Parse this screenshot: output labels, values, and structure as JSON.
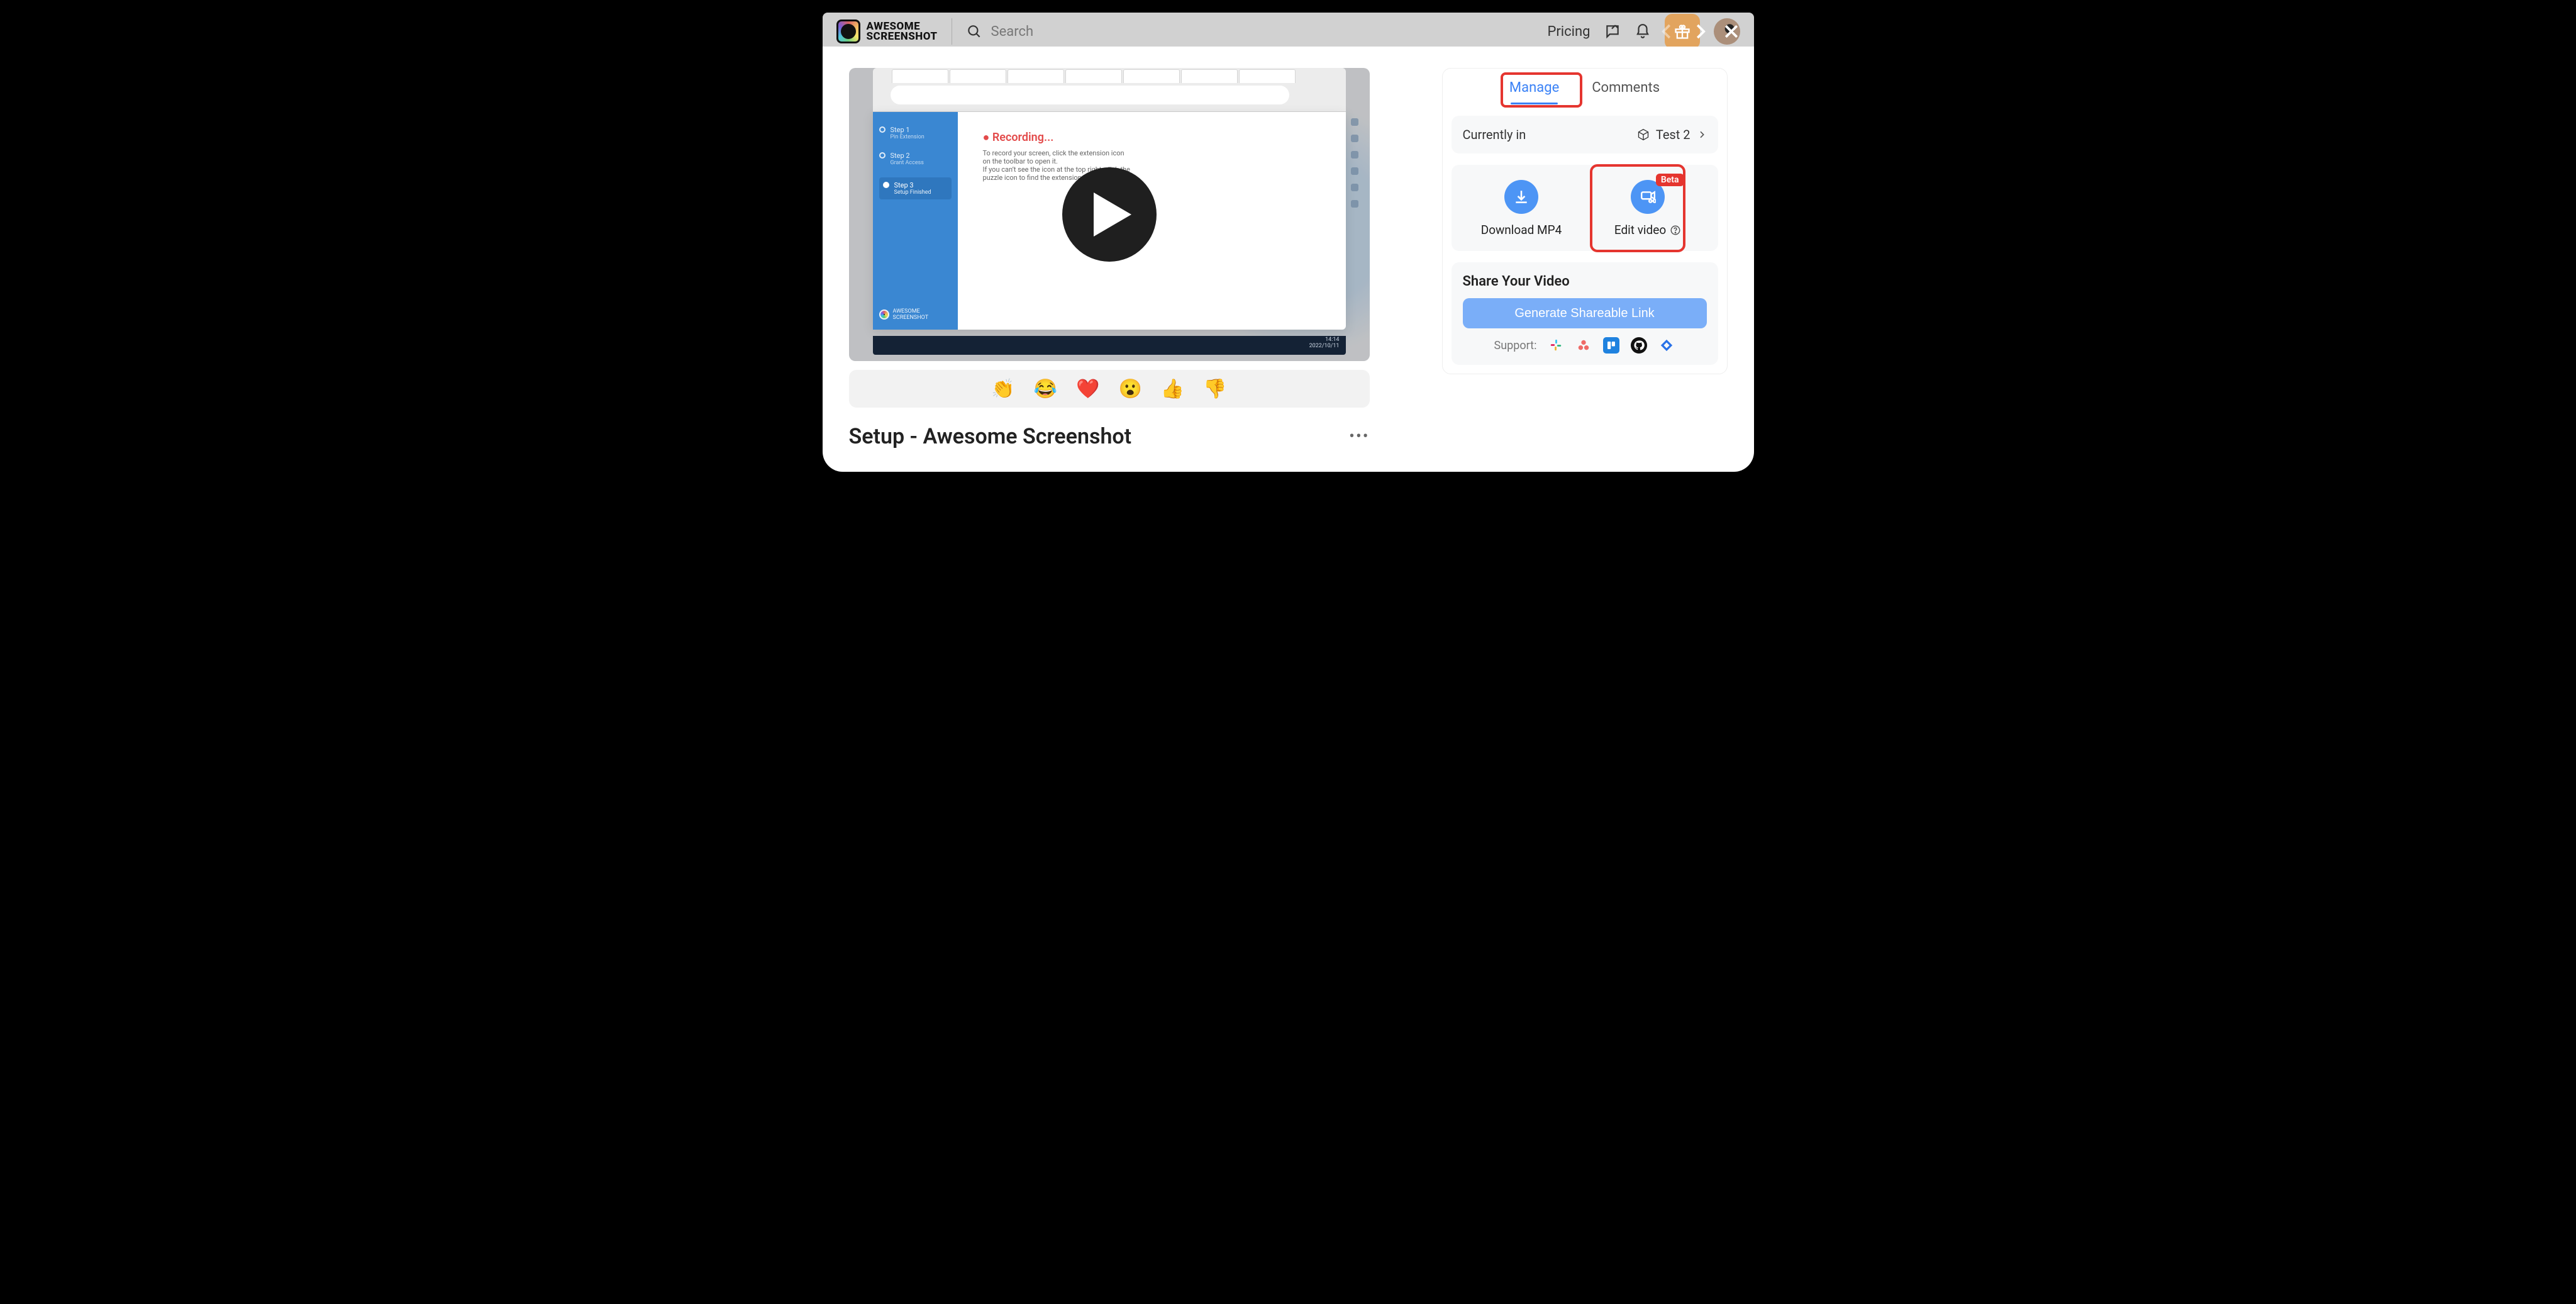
{
  "header": {
    "brand_line1": "AWESOME",
    "brand_line2": "SCREENSHOT",
    "search_placeholder": "Search",
    "pricing_label": "Pricing"
  },
  "modal": {
    "tabs": {
      "manage": "Manage",
      "comments": "Comments"
    },
    "currently_in_label": "Currently in",
    "current_folder": "Test 2",
    "download_label": "Download MP4",
    "edit_label": "Edit video",
    "edit_badge": "Beta",
    "share_title": "Share Your Video",
    "generate_link": "Generate Shareable Link",
    "support_label": "Support:",
    "video_title": "Setup - Awesome Screenshot",
    "preview": {
      "recording_label": "Recording...",
      "step1_title": "Step 1",
      "step1_sub": "Pin Extension",
      "step2_title": "Step 2",
      "step2_sub": "Grant Access",
      "step3_title": "Step 3",
      "step3_sub": "Setup Finished",
      "brand1": "AWESOME",
      "brand2": "SCREENSHOT",
      "line1": "To record your screen, click the extension icon",
      "line2": "on the toolbar to open it.",
      "line3": "If you can’t see the icon at the top right, click the",
      "line4": "puzzle icon to find the extension and Pin it.",
      "clock": "14:14",
      "date": "2022/10/11"
    },
    "reactions": [
      "👏",
      "😂",
      "❤️",
      "😮",
      "👍",
      "👎"
    ]
  }
}
